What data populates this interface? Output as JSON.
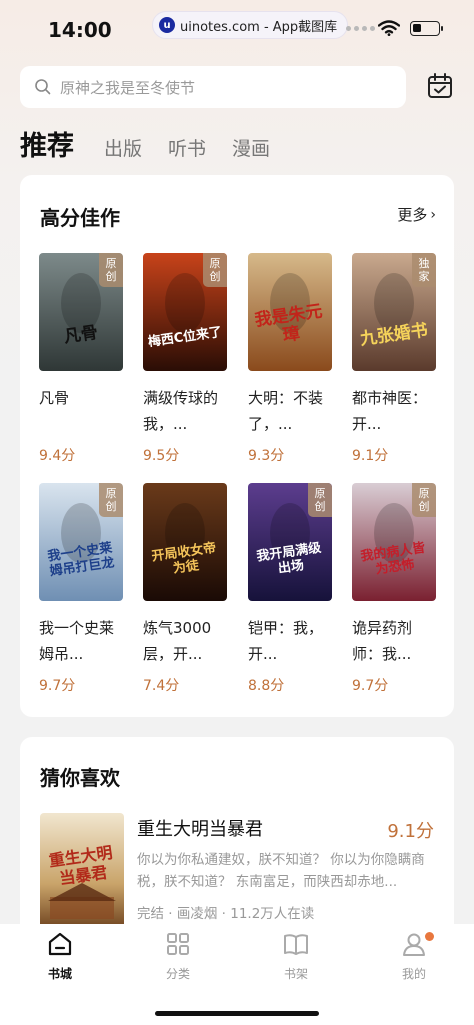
{
  "status_bar": {
    "time": "14:00",
    "url": "uinotes.com - App截图库",
    "url_icon": "u"
  },
  "search": {
    "placeholder": "原神之我是至冬使节"
  },
  "tabs": [
    {
      "label": "推荐",
      "active": true
    },
    {
      "label": "出版"
    },
    {
      "label": "听书"
    },
    {
      "label": "漫画"
    }
  ],
  "high_score": {
    "title": "高分佳作",
    "more_label": "更多",
    "books": [
      {
        "title": "凡骨",
        "score": "9.4分",
        "badge": "原创",
        "cover_text": "凡骨",
        "bg1": "#7d8a8a",
        "bg2": "#2f3736",
        "fg": "#111"
      },
      {
        "title": "满级传球的我，...",
        "score": "9.5分",
        "badge": "原创",
        "cover_text": "梅西C位来了",
        "bg1": "#c8431a",
        "bg2": "#2a0d05",
        "fg": "#fff"
      },
      {
        "title": "大明：不装了，...",
        "score": "9.3分",
        "badge": "",
        "cover_text": "我是朱元璋",
        "bg1": "#d6b98a",
        "bg2": "#8a4a1c",
        "fg": "#c2241a"
      },
      {
        "title": "都市神医：开...",
        "score": "9.1分",
        "badge": "独家",
        "cover_text": "九张婚书",
        "bg1": "#c9a98e",
        "bg2": "#5a3a2c",
        "fg": "#f5d35a"
      },
      {
        "title": "我一个史莱姆吊...",
        "score": "9.7分",
        "badge": "原创",
        "cover_text": "我一个史莱姆吊打巨龙",
        "bg1": "#d9e4ee",
        "bg2": "#6f8fb3",
        "fg": "#1d3f8a"
      },
      {
        "title": "炼气3000层，开...",
        "score": "7.4分",
        "badge": "",
        "cover_text": "开局收女帝为徒",
        "bg1": "#6a3a1a",
        "bg2": "#1a0a05",
        "fg": "#f4c45a"
      },
      {
        "title": "铠甲：我，开...",
        "score": "8.8分",
        "badge": "原创",
        "cover_text": "我开局满级出场",
        "bg1": "#5c3d8e",
        "bg2": "#16123a",
        "fg": "#fff"
      },
      {
        "title": "诡异药剂师：我...",
        "score": "9.7分",
        "badge": "原创",
        "cover_text": "我的病人皆为恐怖",
        "bg1": "#d9cdd4",
        "bg2": "#7a2030",
        "fg": "#c41e2a"
      }
    ]
  },
  "guess": {
    "title": "猜你喜欢",
    "item": {
      "title": "重生大明当暴君",
      "score": "9.1分",
      "description": "你以为你私通建奴，朕不知道？ 你以为你隐瞒商税，朕不知道？ 东南富足，而陕西却赤地...",
      "meta": "完结 · 画凌烟 · 11.2万人在读",
      "cover_text": "重生大明当暴君"
    }
  },
  "bottom_nav": [
    {
      "label": "书城",
      "icon": "home-icon",
      "active": true
    },
    {
      "label": "分类",
      "icon": "grid-icon"
    },
    {
      "label": "书架",
      "icon": "book-icon"
    },
    {
      "label": "我的",
      "icon": "person-icon",
      "badge_dot": true
    }
  ],
  "colors": {
    "score": "#c0713a",
    "accent_dot": "#e8773e",
    "badge": "#aa8c6e"
  }
}
